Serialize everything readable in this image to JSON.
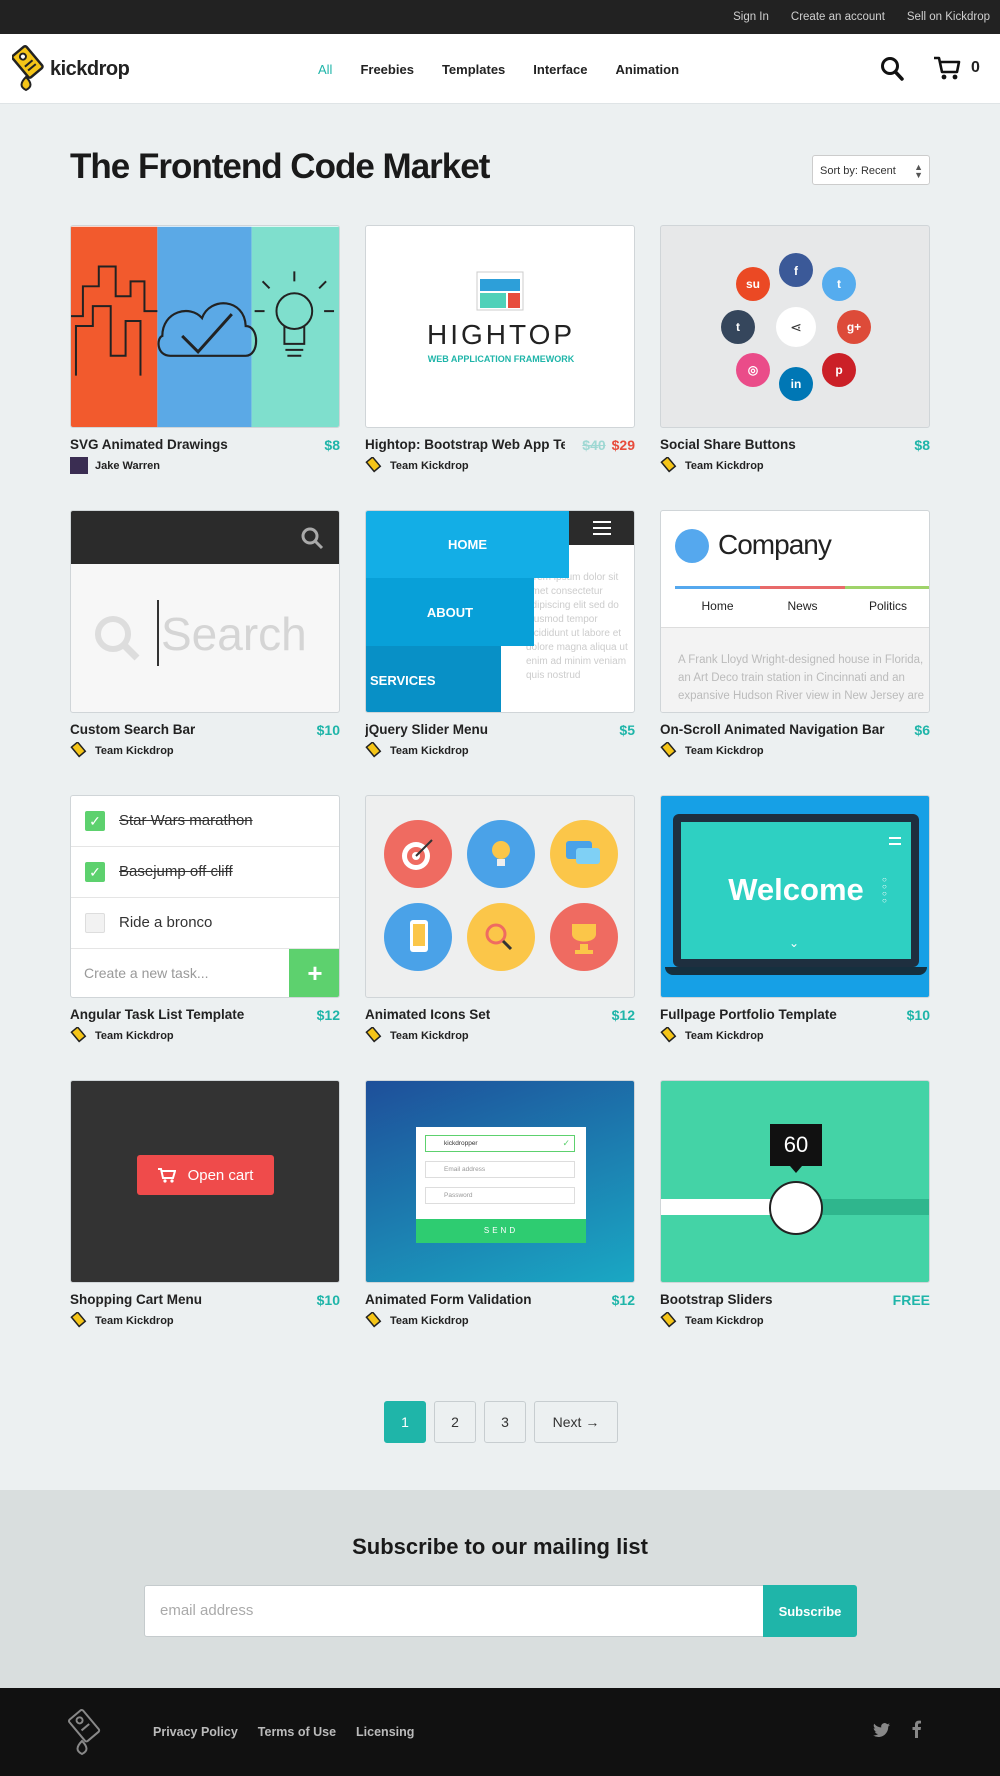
{
  "topbar": {
    "links": [
      "Sign In",
      "Create an account",
      "Sell on Kickdrop"
    ]
  },
  "header": {
    "logo_text": "kickdrop",
    "nav": [
      "All",
      "Freebies",
      "Templates",
      "Interface",
      "Animation"
    ],
    "active_nav": "All",
    "cart_count": "0",
    "icons": [
      "search-icon",
      "cart-icon"
    ]
  },
  "page": {
    "title": "The Frontend Code Market",
    "sort_value": "Sort by: Recent"
  },
  "products": [
    {
      "title": "SVG Animated Drawings",
      "author": "Jake Warren",
      "price": "$8"
    },
    {
      "title": "Hightop: Bootstrap Web App Te...",
      "author": "Team Kickdrop",
      "old_price": "$40",
      "price": "$29"
    },
    {
      "title": "Social Share Buttons",
      "author": "Team Kickdrop",
      "price": "$8"
    },
    {
      "title": "Custom Search Bar",
      "author": "Team Kickdrop",
      "price": "$10"
    },
    {
      "title": "jQuery Slider Menu",
      "author": "Team Kickdrop",
      "price": "$5"
    },
    {
      "title": "On-Scroll Animated Navigation Bar",
      "author": "Team Kickdrop",
      "price": "$6"
    },
    {
      "title": "Angular Task List Template",
      "author": "Team Kickdrop",
      "price": "$12"
    },
    {
      "title": "Animated Icons Set",
      "author": "Team Kickdrop",
      "price": "$12"
    },
    {
      "title": "Fullpage Portfolio Template",
      "author": "Team Kickdrop",
      "price": "$10"
    },
    {
      "title": "Shopping Cart Menu",
      "author": "Team Kickdrop",
      "price": "$10"
    },
    {
      "title": "Animated Form Validation",
      "author": "Team Kickdrop",
      "price": "$12"
    },
    {
      "title": "Bootstrap Sliders",
      "author": "Team Kickdrop",
      "price": "FREE"
    }
  ],
  "thumbs": {
    "hightop_name": "HIGHTOP",
    "hightop_sub": "WEB APPLICATION FRAMEWORK",
    "search_placeholder": "Search",
    "slider_menu": [
      "HOME",
      "ABOUT",
      "SERVICES"
    ],
    "nav_company": "Company",
    "nav_tabs": [
      "Home",
      "News",
      "Politics"
    ],
    "nav_body": "A Frank Lloyd Wright-designed house in Florida, an Art Deco train station in Cincinnati and an expansive Hudson River view in New Jersey are",
    "tasks": [
      "Star Wars marathon",
      "Basejump off cliff",
      "Ride a bronco"
    ],
    "task_placeholder": "Create a new task...",
    "welcome": "Welcome",
    "open_cart": "Open cart",
    "form_user": "kickdropper",
    "form_email": "Email address",
    "form_password": "Password",
    "form_send": "SEND",
    "slider_value": "60"
  },
  "pagination": {
    "pages": [
      "1",
      "2",
      "3"
    ],
    "next": "Next →",
    "current": "1"
  },
  "subscribe": {
    "title": "Subscribe to our mailing list",
    "placeholder": "email address",
    "button": "Subscribe"
  },
  "footer": {
    "links": [
      "Privacy Policy",
      "Terms of Use",
      "Licensing"
    ],
    "social": [
      "twitter-icon",
      "facebook-icon"
    ]
  },
  "colors": {
    "accent": "#1fb5a9",
    "sale": "#e74c3c",
    "dark": "#222222"
  }
}
